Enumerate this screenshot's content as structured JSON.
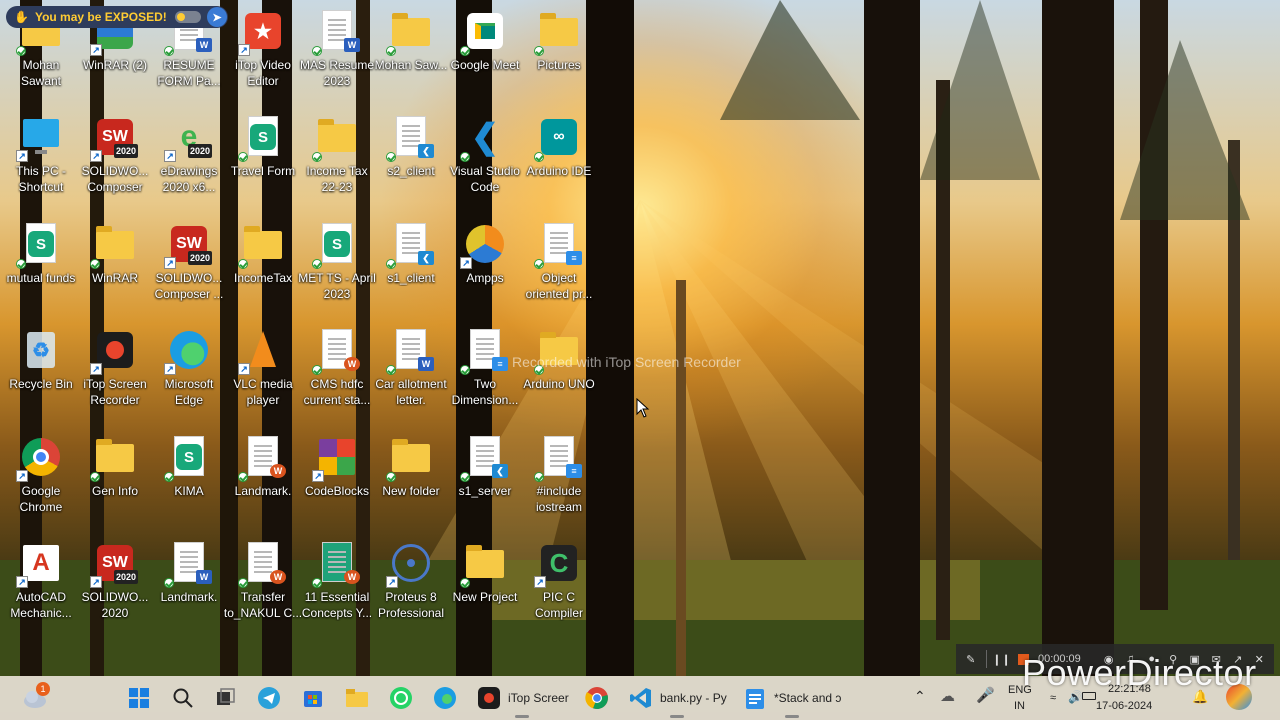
{
  "banner": {
    "text": "You may be EXPOSED!",
    "color": "#ffcc33"
  },
  "desktop": {
    "icons": [
      {
        "label": "Mohan Sawant",
        "icon": "user-folder-icon",
        "col": 0,
        "row": 0
      },
      {
        "label": "WinRAR (2)",
        "icon": "winrar-icon",
        "col": 1,
        "row": 0
      },
      {
        "label": "RESUME FORM Pa...",
        "icon": "word-doc-icon",
        "col": 2,
        "row": 0
      },
      {
        "label": "iTop Video Editor",
        "icon": "itop-video-editor-icon",
        "col": 3,
        "row": 0
      },
      {
        "label": "MAS Resume 2023",
        "icon": "word-doc-icon",
        "col": 4,
        "row": 0
      },
      {
        "label": "Mohan Saw...",
        "icon": "folder-icon",
        "col": 5,
        "row": 0
      },
      {
        "label": "Google Meet",
        "icon": "google-meet-icon",
        "col": 6,
        "row": 0
      },
      {
        "label": "Pictures",
        "icon": "folder-icon",
        "col": 7,
        "row": 0
      },
      {
        "label": "This PC - Shortcut",
        "icon": "monitor-icon",
        "col": 0,
        "row": 1
      },
      {
        "label": "SOLIDWO... Composer",
        "icon": "solidworks-icon",
        "col": 1,
        "row": 1
      },
      {
        "label": "eDrawings 2020 x6...",
        "icon": "edrawings-icon",
        "col": 2,
        "row": 1
      },
      {
        "label": "Travel Form",
        "icon": "wps-sheet-icon",
        "col": 3,
        "row": 1
      },
      {
        "label": "Income Tax 22-23",
        "icon": "folder-icon",
        "col": 4,
        "row": 1
      },
      {
        "label": "s2_client",
        "icon": "vscode-file-icon",
        "col": 5,
        "row": 1
      },
      {
        "label": "Visual Studio Code",
        "icon": "vscode-icon",
        "col": 6,
        "row": 1
      },
      {
        "label": "Arduino IDE",
        "icon": "arduino-icon",
        "col": 7,
        "row": 1
      },
      {
        "label": "mutual funds",
        "icon": "wps-sheet-icon",
        "col": 0,
        "row": 2
      },
      {
        "label": "WinRAR",
        "icon": "folder-icon",
        "col": 1,
        "row": 2
      },
      {
        "label": "SOLIDWO... Composer ...",
        "icon": "solidworks-icon",
        "col": 2,
        "row": 2
      },
      {
        "label": "IncomeTax",
        "icon": "folder-icon",
        "col": 3,
        "row": 2
      },
      {
        "label": "MET TS - April 2023",
        "icon": "wps-sheet-icon",
        "col": 4,
        "row": 2
      },
      {
        "label": "s1_client",
        "icon": "vscode-file-icon",
        "col": 5,
        "row": 2
      },
      {
        "label": "Ampps",
        "icon": "ampps-icon",
        "col": 6,
        "row": 2
      },
      {
        "label": "Object oriented pr...",
        "icon": "notepad-doc-icon",
        "col": 7,
        "row": 2
      },
      {
        "label": "Recycle Bin",
        "icon": "recycle-bin-icon",
        "col": 0,
        "row": 3
      },
      {
        "label": "iTop Screen Recorder",
        "icon": "itop-recorder-icon",
        "col": 1,
        "row": 3
      },
      {
        "label": "Microsoft Edge",
        "icon": "edge-icon",
        "col": 2,
        "row": 3
      },
      {
        "label": "VLC media player",
        "icon": "vlc-icon",
        "col": 3,
        "row": 3
      },
      {
        "label": "CMS hdfc current sta...",
        "icon": "wps-doc-icon",
        "col": 4,
        "row": 3
      },
      {
        "label": "Car allotment letter.",
        "icon": "word-doc-icon",
        "col": 5,
        "row": 3
      },
      {
        "label": "Two Dimension...",
        "icon": "notepad-doc-icon",
        "col": 6,
        "row": 3
      },
      {
        "label": "Arduino UNO",
        "icon": "folder-icon",
        "col": 7,
        "row": 3
      },
      {
        "label": "Google Chrome",
        "icon": "chrome-icon",
        "col": 0,
        "row": 4
      },
      {
        "label": "Gen Info",
        "icon": "folder-icon",
        "col": 1,
        "row": 4
      },
      {
        "label": "KIMA",
        "icon": "wps-sheet-icon",
        "col": 2,
        "row": 4
      },
      {
        "label": "Landmark.",
        "icon": "wps-doc-icon",
        "col": 3,
        "row": 4
      },
      {
        "label": "CodeBlocks",
        "icon": "codeblocks-icon",
        "col": 4,
        "row": 4
      },
      {
        "label": "New folder",
        "icon": "folder-icon",
        "col": 5,
        "row": 4
      },
      {
        "label": "s1_server",
        "icon": "vscode-file-icon",
        "col": 6,
        "row": 4
      },
      {
        "label": "#include iostream",
        "icon": "notepad-doc-icon",
        "col": 7,
        "row": 4
      },
      {
        "label": "AutoCAD Mechanic...",
        "icon": "autocad-icon",
        "col": 0,
        "row": 5
      },
      {
        "label": "SOLIDWO... 2020",
        "icon": "solidworks-icon",
        "col": 1,
        "row": 5
      },
      {
        "label": "Landmark.",
        "icon": "word-doc-icon",
        "col": 2,
        "row": 5
      },
      {
        "label": "Transfer to_NAKUL C...",
        "icon": "wps-doc-icon",
        "col": 3,
        "row": 5
      },
      {
        "label": "11 Essential Concepts Y...",
        "icon": "book-doc-icon",
        "col": 4,
        "row": 5
      },
      {
        "label": "Proteus 8 Professional",
        "icon": "proteus-icon",
        "col": 5,
        "row": 5
      },
      {
        "label": "New Project",
        "icon": "folder-icon",
        "col": 6,
        "row": 5
      },
      {
        "label": "PIC C Compiler",
        "icon": "pic-c-icon",
        "col": 7,
        "row": 5
      }
    ]
  },
  "watermark": "Recorded with iTop Screen Recorder",
  "recorder": {
    "timer": "00:00:09"
  },
  "taskbar": {
    "weather_badge": "1",
    "itop_label": "iTop Screer",
    "vscode_label": "bank.py - Pу",
    "notepad_label": "*Stack and ɔ",
    "lang_top": "ENG",
    "lang_bottom": "IN",
    "time": "22:21:48",
    "date": "17-06-2024"
  },
  "powerdirector": "PowerDirector",
  "colors": {
    "accent": "#0a64c8",
    "folder": "#f6c945",
    "banner_bg": "#2e3c5c"
  }
}
